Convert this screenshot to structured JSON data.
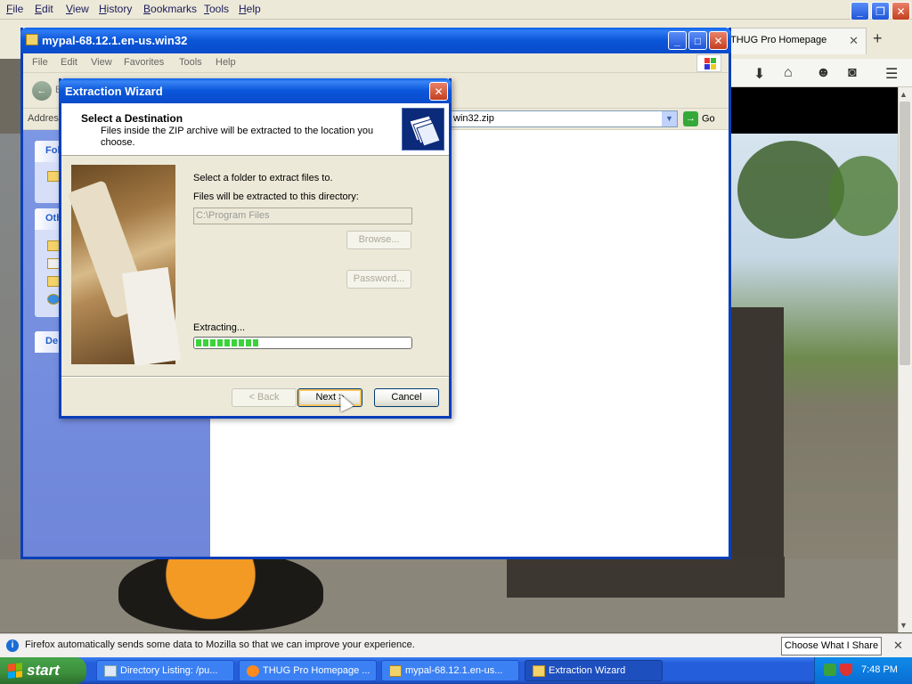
{
  "firefox": {
    "menu": [
      "File",
      "Edit",
      "View",
      "History",
      "Bookmarks",
      "Tools",
      "Help"
    ],
    "tab": {
      "title": "THUG Pro Homepage",
      "close": "✕"
    },
    "new_tab": "+",
    "notification": {
      "text": "Firefox automatically sends some data to Mozilla so that we can improve your experience.",
      "button": "Choose What I Share",
      "close": "✕"
    }
  },
  "explorer": {
    "title": "mypal-68.12.1.en-us.win32",
    "menu": [
      "File",
      "Edit",
      "View",
      "Favorites",
      "Tools",
      "Help"
    ],
    "back_label": "B",
    "address_label": "Address",
    "address_value": "win32.zip",
    "go_label": "Go",
    "side_panels": [
      "Fol",
      "Oth",
      "De"
    ]
  },
  "wizard": {
    "title": "Extraction Wizard",
    "header_title": "Select a Destination",
    "header_subtitle": "Files inside the ZIP archive will be extracted to the location you choose.",
    "select_folder_text": "Select a folder to extract files to.",
    "directory_label": "Files will be extracted to this directory:",
    "directory_value": "C:\\Program Files",
    "browse_label": "Browse...",
    "password_label": "Password...",
    "progress_label": "Extracting...",
    "progress_fraction": 0.3,
    "back_label": "< Back",
    "next_label": "Next >",
    "cancel_label": "Cancel"
  },
  "taskbar": {
    "start_label": "start",
    "items": [
      {
        "label": "Directory Listing: /pu...",
        "icon": "ie-icon"
      },
      {
        "label": "THUG Pro Homepage ...",
        "icon": "firefox-icon"
      },
      {
        "label": "mypal-68.12.1.en-us...",
        "icon": "zip-folder-icon"
      },
      {
        "label": "Extraction Wizard",
        "icon": "folder-icon"
      }
    ],
    "clock": "7:48 PM"
  }
}
